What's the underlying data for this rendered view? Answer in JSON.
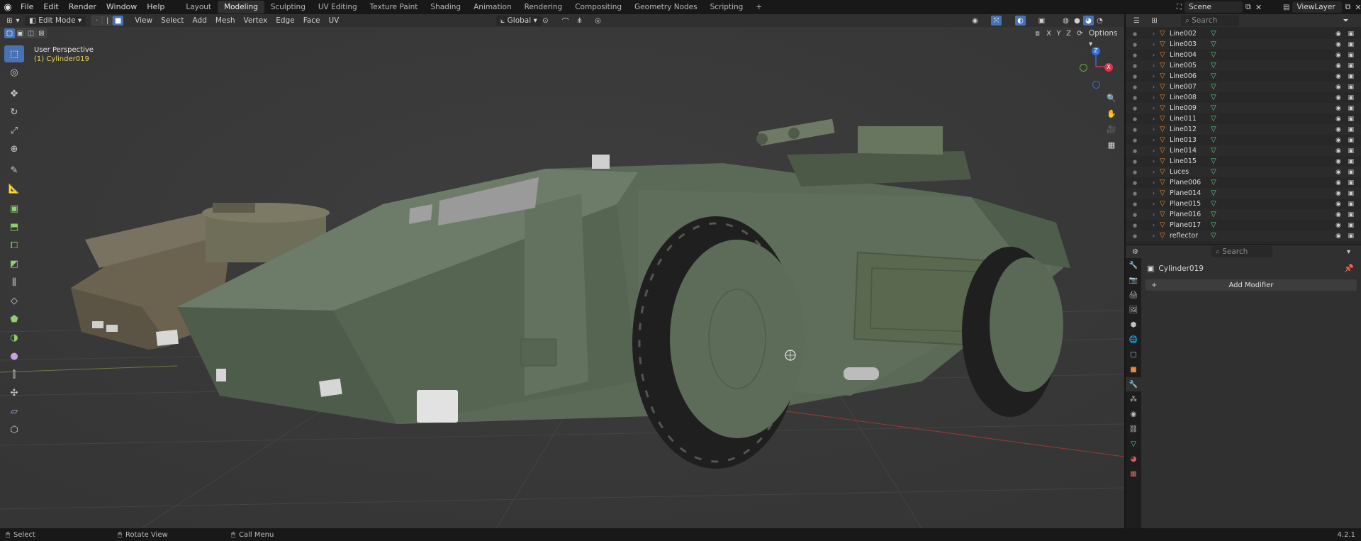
{
  "topbar": {
    "menus": [
      "File",
      "Edit",
      "Render",
      "Window",
      "Help"
    ],
    "workspaces": [
      "Layout",
      "Modeling",
      "Sculpting",
      "UV Editing",
      "Texture Paint",
      "Shading",
      "Animation",
      "Rendering",
      "Compositing",
      "Geometry Nodes",
      "Scripting"
    ],
    "active_workspace": "Modeling",
    "add_workspace": "+",
    "scene_label": "Scene",
    "viewlayer_label": "ViewLayer"
  },
  "viewport_header": {
    "mode": "Edit Mode",
    "menus": [
      "View",
      "Select",
      "Add",
      "Mesh",
      "Vertex",
      "Edge",
      "Face",
      "UV"
    ],
    "transform_orientation": "Global",
    "options_label": "Options",
    "axis_x": "X",
    "axis_y": "Y",
    "axis_z": "Z"
  },
  "viewport": {
    "perspective_label": "User Perspective",
    "object_label": "(1) Cylinder019",
    "gizmo": {
      "z": "Z",
      "x": "X"
    }
  },
  "outliner": {
    "search_placeholder": "Search",
    "items": [
      {
        "name": "Line002"
      },
      {
        "name": "Line003"
      },
      {
        "name": "Line004"
      },
      {
        "name": "Line005"
      },
      {
        "name": "Line006"
      },
      {
        "name": "Line007"
      },
      {
        "name": "Line008"
      },
      {
        "name": "Line009"
      },
      {
        "name": "Line011"
      },
      {
        "name": "Line012"
      },
      {
        "name": "Line013"
      },
      {
        "name": "Line014"
      },
      {
        "name": "Line015"
      },
      {
        "name": "Luces"
      },
      {
        "name": "Plane006"
      },
      {
        "name": "Plane014"
      },
      {
        "name": "Plane015"
      },
      {
        "name": "Plane016"
      },
      {
        "name": "Plane017"
      },
      {
        "name": "reflector"
      }
    ]
  },
  "properties": {
    "search_placeholder": "Search",
    "object_name": "Cylinder019",
    "add_modifier_label": "Add Modifier"
  },
  "statusbar": {
    "select": "Select",
    "rotate": "Rotate View",
    "menu": "Call Menu",
    "version": "4.2.1"
  },
  "colors": {
    "accent": "#4772b3",
    "vehicle_body": "#5c6a58",
    "viewport_bg": "#393939"
  }
}
